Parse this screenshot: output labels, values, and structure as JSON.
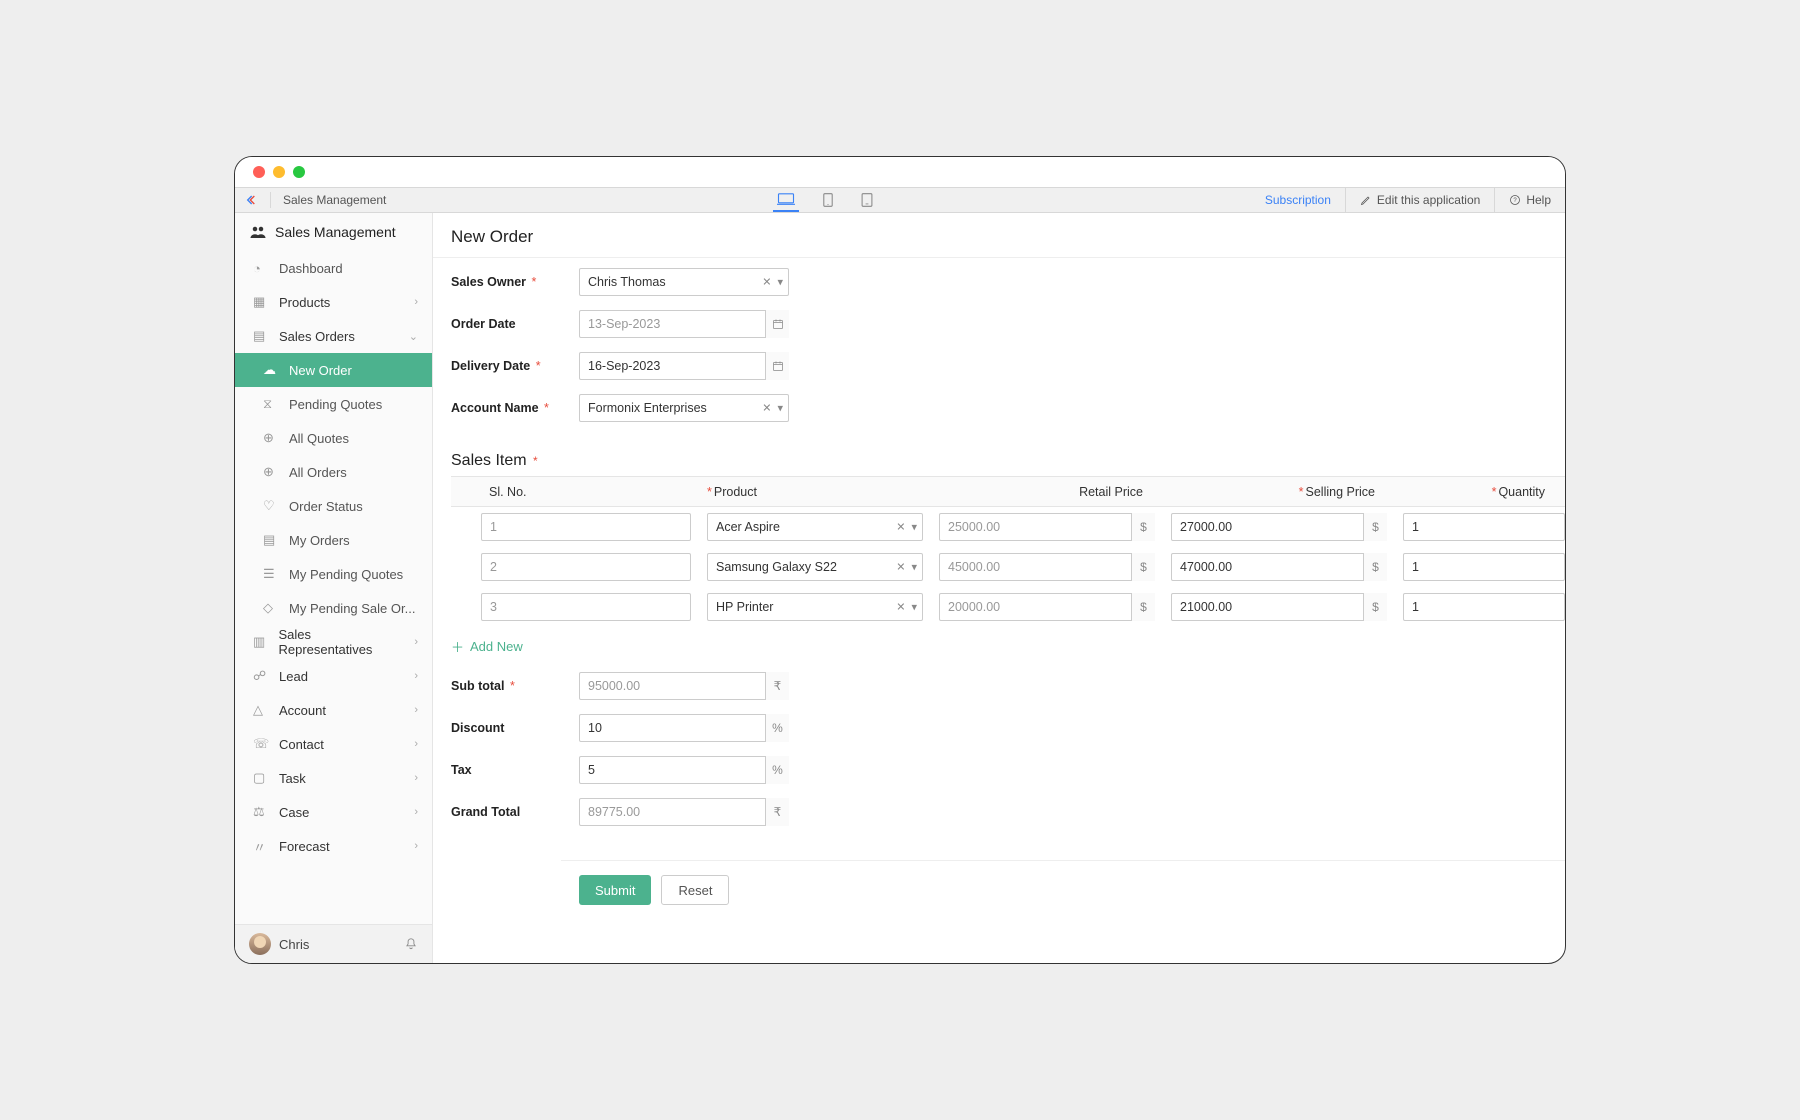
{
  "topbar": {
    "title": "Sales Management",
    "subscription": "Subscription",
    "edit": "Edit this application",
    "help": "Help"
  },
  "sidebar": {
    "app_name": "Sales Management",
    "items": [
      {
        "label": "Dashboard"
      },
      {
        "label": "Products"
      },
      {
        "label": "Sales Orders"
      },
      {
        "label": "Sales Representatives"
      },
      {
        "label": "Lead"
      },
      {
        "label": "Account"
      },
      {
        "label": "Contact"
      },
      {
        "label": "Task"
      },
      {
        "label": "Case"
      },
      {
        "label": "Forecast"
      }
    ],
    "sales_children": [
      {
        "label": "New Order"
      },
      {
        "label": "Pending Quotes"
      },
      {
        "label": "All Quotes"
      },
      {
        "label": "All Orders"
      },
      {
        "label": "Order Status"
      },
      {
        "label": "My Orders"
      },
      {
        "label": "My Pending Quotes"
      },
      {
        "label": "My Pending Sale Or..."
      }
    ],
    "user": "Chris"
  },
  "page": {
    "title": "New Order",
    "labels": {
      "sales_owner": "Sales Owner",
      "order_date": "Order Date",
      "delivery_date": "Delivery Date",
      "account_name": "Account Name",
      "sales_item": "Sales Item",
      "add_new": "Add New",
      "subtotal": "Sub total",
      "discount": "Discount",
      "tax": "Tax",
      "grand_total": "Grand Total",
      "submit": "Submit",
      "reset": "Reset"
    },
    "values": {
      "sales_owner": "Chris Thomas",
      "order_date": "13-Sep-2023",
      "delivery_date": "16-Sep-2023",
      "account_name": "Formonix Enterprises",
      "subtotal": "95000.00",
      "discount": "10",
      "tax": "5",
      "grand_total": "89775.00"
    },
    "columns": {
      "slno": "Sl. No.",
      "product": "Product",
      "retail": "Retail Price",
      "selling": "Selling Price",
      "qty": "Quantity"
    },
    "rows": [
      {
        "sl": "1",
        "product": "Acer Aspire",
        "retail": "25000.00",
        "selling": "27000.00",
        "qty": "1"
      },
      {
        "sl": "2",
        "product": "Samsung Galaxy S22",
        "retail": "45000.00",
        "selling": "47000.00",
        "qty": "1"
      },
      {
        "sl": "3",
        "product": "HP Printer",
        "retail": "20000.00",
        "selling": "21000.00",
        "qty": "1"
      }
    ]
  }
}
